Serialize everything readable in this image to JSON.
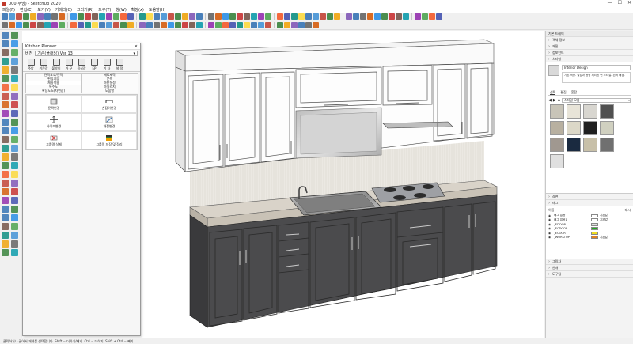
{
  "titlebar": {
    "title": "000(주방) - SketchUp 2020",
    "min": "—",
    "max": "☐",
    "close": "✕"
  },
  "menu": [
    "파일(F)",
    "편집(E)",
    "보기(V)",
    "카메라(C)",
    "그리기(R)",
    "도구(T)",
    "창(W)",
    "확장(x)",
    "도움말(H)"
  ],
  "toolbar_colors": [
    "#2b6cb0",
    "#3a8dd4",
    "#c0392b",
    "#2e7d32",
    "#f0a000",
    "#7a4fb3",
    "#2b6cb0",
    "#5d5d5d",
    "#d35400",
    "#1e88e5",
    "#2e7d32",
    "#c62828",
    "#6d4c41",
    "#0097a7",
    "#8e24aa",
    "#43a047",
    "#f4511e",
    "#3949ab",
    "#00897b",
    "#fdd835"
  ],
  "kitchen_planner": {
    "title": "Kitchen Planner",
    "version_label": "버전",
    "version_value": "기존(플래닝) Ver 13",
    "tools": [
      {
        "name": "주방",
        "icon": "kitchen-icon"
      },
      {
        "name": "키큰장",
        "icon": "tall-cabinet-icon"
      },
      {
        "name": "붙박이",
        "icon": "builtin-icon"
      },
      {
        "name": "가 구",
        "icon": "furniture-icon"
      },
      {
        "name": "욕실장",
        "icon": "bathroom-cabinet-icon"
      },
      {
        "name": "EP",
        "icon": "ep-icon"
      },
      {
        "name": "기 타",
        "icon": "misc-icon"
      },
      {
        "name": "설 정",
        "icon": "settings-icon"
      }
    ],
    "tabs": [
      "견적요소/견적",
      "재료제작",
      "편집기능",
      "문짝",
      "재질적용",
      "하판설정",
      "특수도",
      "마일리지",
      "확장도 E(자연광)",
      "도움말"
    ],
    "buttons": [
      {
        "label": "문짝변경"
      },
      {
        "label": "손잡이변경"
      },
      {
        "label": "사이즈변경"
      },
      {
        "label": "재질변경"
      },
      {
        "label": "그룹명 삭제"
      },
      {
        "label": "그룹명 저장 및 정리"
      }
    ]
  },
  "right_panel": {
    "title": "기본 트레이",
    "sections_top": [
      "객체 정보",
      "재질",
      "컴포넌트",
      "스타일"
    ],
    "style": {
      "name": "Interior Design",
      "description": "기본 색상. 질감과 음영 처리된 면 스타일. 흰색 배경.",
      "tabs": [
        "선택",
        "편집",
        "혼합"
      ],
      "dropdown": "스타일 모음",
      "thumb_colors": [
        "#c8c4b8",
        "#e8e4d8",
        "#d8d6d0",
        "#505050",
        "#b8b0a0",
        "#dcd8c8",
        "#202020",
        "#d0d0c0",
        "#a09890",
        "#1a2a40",
        "#c8c0a8",
        "#707070",
        "#e0e0e0"
      ]
    },
    "sections_mid": [
      "장면",
      "태그"
    ],
    "tags": {
      "header_name": "이름",
      "header_color": "대시",
      "rows": [
        {
          "name": "태그 없음",
          "color": "#ffffff",
          "dash": "기본값"
        },
        {
          "name": "태그 없음1",
          "color": "#ffffff",
          "dash": "기본값"
        },
        {
          "name": "_EDOOR",
          "color": "#e0e0e0",
          "dash": ""
        },
        {
          "name": "_ECDOOR",
          "color": "#22aa22",
          "dash": ""
        },
        {
          "name": "_ECOOR",
          "color": "#eedd22",
          "dash": ""
        },
        {
          "name": "_WORKTOP",
          "color": "#e08020",
          "dash": "기본값"
        }
      ]
    },
    "sections_bottom": [
      "그림자",
      "안개",
      "도구팁"
    ]
  },
  "status": "클릭하거나 끌어서 개체를 선택합니다. Shift = 더하기/빼기. Ctrl = 더하기. Shift + Ctrl = 빼기."
}
